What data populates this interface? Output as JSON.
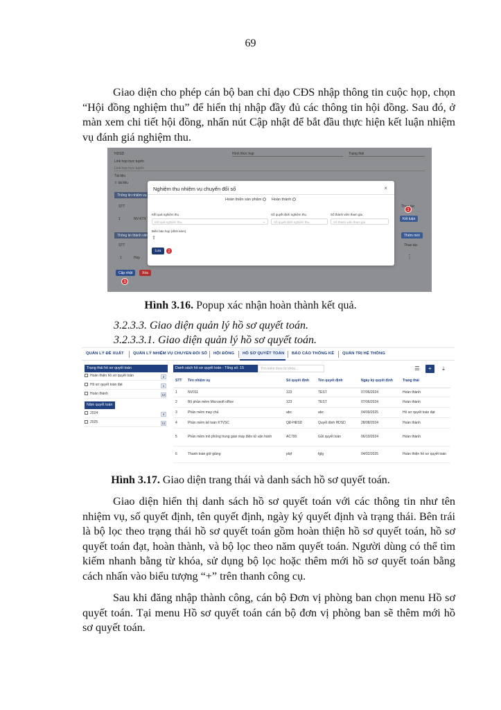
{
  "page_number": "69",
  "para1": "Giao diện cho phép cán bộ ban chỉ đạo CĐS nhập thông tin cuộc họp, chọn “Hội đồng nghiệm thu” để hiển thị nhập đầy đủ các thông tin hội đồng. Sau đó, ở màn xem chi tiết hội đồng, nhấn nút Cập nhật để bắt đầu thực hiện kết luận nhiệm vụ đánh giá nghiệm thu.",
  "figure1": {
    "background": {
      "hdsd": "HDSD",
      "link_label": "Link họp trực tuyến",
      "link_placeholder": "Link họp trực tuyến",
      "attach_label": "Tài liệu",
      "attach_value": "tài liệu",
      "section1": "Thông tin nhiệm vụ",
      "section2": "Thông tin thành viên",
      "col_stt": "STT",
      "col_thaotac": "Thao tác",
      "row1_stt": "1",
      "row1_code": "NV-KTV",
      "row2_stt": "1",
      "row2_name": "Huy",
      "btn_ketluan": "Kết luận",
      "btn_themmoi": "Thêm mới",
      "btn_capnhat": "Cập nhật",
      "btn_xoa": "Xóa",
      "dropdown1": "Hình thức họp",
      "dropdown2": "Trạng thái"
    },
    "markers": [
      "1",
      "2",
      "3"
    ],
    "modal": {
      "title": "Nghiệm thu nhiệm vụ chuyển đổi số",
      "close": "×",
      "radio1": "Hoàn thiện sản phẩm",
      "radio2": "Hoàn thành",
      "field1_label": "Kết quả nghiệm thu",
      "field1_placeholder": "Kết quả nghiệm thu",
      "field2_label": "Số quyết định nghiệm thu",
      "field2_placeholder": "Số quyết định nghiệm thu",
      "field3_label": "Số thành viên tham gia",
      "field3_placeholder": "Số thành viên tham gia",
      "attach_label": "Biên bản họp (đính kèm)",
      "upload_icon": "upload-icon",
      "save_label": "Lưu"
    }
  },
  "caption1_bold": "Hình 3.16.",
  "caption1_text": " Popup xác nhận hoàn thành kết quả.",
  "heading1": "3.2.3.3. Giao diện quản lý hồ sơ quyết toán.",
  "heading2": "3.2.3.3.1. Giao diện quản lý hồ sơ quyết toán.",
  "figure2": {
    "nav": [
      "QUẢN LÝ ĐỀ XUẤT",
      "QUẢN LÝ NHIỆM VỤ CHUYỂN ĐỔI SỐ",
      "HỘI ĐỒNG",
      "HỒ SƠ QUYẾT TOÁN",
      "BÁO CÁO THỐNG KÊ",
      "QUẢN TRỊ HỆ THỐNG"
    ],
    "status_filter_title": "Trạng thái hồ sơ quyết toán",
    "status_filters": [
      {
        "label": "Hoàn thiện hồ sơ quyết toán",
        "count": "2"
      },
      {
        "label": "Hồ sơ quyết toán đạt",
        "count": "1"
      },
      {
        "label": "Hoàn thành",
        "count": "10"
      }
    ],
    "year_filter_title": "Năm quyết toán",
    "year_filters": [
      {
        "label": "2024",
        "count": "4"
      },
      {
        "label": "2025",
        "count": "11"
      }
    ],
    "list_title": "Danh sách hồ sơ quyết toán - Tổng số: 15",
    "search_placeholder": "Tìm kiếm theo từ khóa...",
    "columns": [
      "STT",
      "Tên nhiệm vụ",
      "Số quyết định",
      "Tên quyết định",
      "Ngày ký quyết định",
      "Trạng thái"
    ],
    "rows": [
      [
        "1",
        "NV011",
        "123",
        "TEST",
        "07/06/2024",
        "Hoàn thành"
      ],
      [
        "2",
        "Bộ phần mềm Microsoft office",
        "123",
        "TEST",
        "07/06/2024",
        "Hoàn thành"
      ],
      [
        "3",
        "Phần mềm may chủ",
        "abc",
        "abc",
        "04/09/2025",
        "Hồ sơ quyết toán đạt"
      ],
      [
        "4",
        "Phần mềm kế toán KTVSC",
        "QĐ-HĐSD",
        "Quyết định HDSD",
        "28/08/2024",
        "Hoàn thành"
      ],
      [
        "5",
        "Phần mềm mô phỏng trung gian máy điện tử vận hành",
        "AC700",
        "Gửi quyết toán",
        "06/10/2024",
        "Hoàn thành"
      ],
      [
        "6",
        "Thanh toán giờ giảng",
        "plqf",
        "fglg",
        "04/02/2025",
        "Hoàn thiện hồ sơ quyết toán"
      ]
    ]
  },
  "caption2_bold": "Hình 3.17.",
  "caption2_text": " Giao diện trang thái và danh sách hồ sơ quyết toán.",
  "para2": "Giao diện hiển thị danh sách hồ sơ quyết toán với các thông tin như tên nhiệm vụ, số quyết định, tên quyết định, ngày ký quyết định và trạng thái. Bên trái là bộ lọc theo trạng thái hồ sơ quyết toán gồm hoàn thiện hồ sơ quyết toán, hồ sơ quyết toán đạt, hoàn thành, và bộ lọc theo năm quyết toán. Người dùng có thể tìm kiếm nhanh bằng từ khóa, sử dụng bộ lọc hoặc thêm mới hồ sơ quyết toán bằng cách nhấn vào biểu tượng “+” trên thanh công cụ.",
  "para3": "Sau khi đăng nhập thành công, cán bộ Đơn vị phòng ban chọn menu Hồ sơ quyết toán. Tại menu Hồ sơ quyết toán cán bộ đơn vị phòng ban sẽ thêm mới hồ sơ quyết toán."
}
